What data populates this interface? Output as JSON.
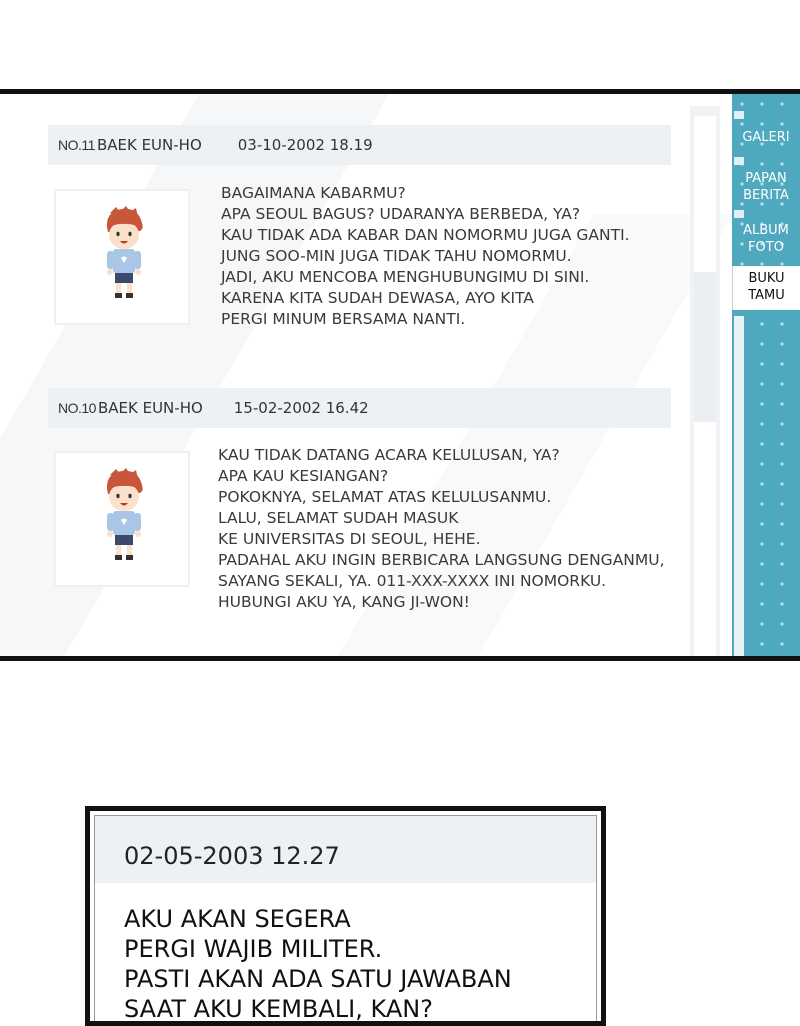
{
  "tabs": [
    {
      "label_line1": "GALERI",
      "label_line2": ""
    },
    {
      "label_line1": "PAPAN",
      "label_line2": "BERITA"
    },
    {
      "label_line1": "ALBUM",
      "label_line2": "FOTO"
    },
    {
      "label_line1": "BUKU",
      "label_line2": "TAMU"
    }
  ],
  "active_tab": "BUKU TAMU",
  "entries": [
    {
      "no": "NO.11",
      "author": "BAEK EUN-HO",
      "datetime": "03-10-2002 18.19",
      "avatar": "boy-avatar-icon",
      "lines": [
        "BAGAIMANA KABARMU?",
        "APA SEOUL BAGUS? UDARANYA BERBEDA, YA?",
        "KAU TIDAK ADA KABAR DAN NOMORMU JUGA GANTI.",
        "JUNG SOO-MIN JUGA TIDAK TAHU NOMORMU.",
        "JADI, AKU MENCOBA MENGHUBUNGIMU DI SINI.",
        "KARENA KITA SUDAH DEWASA, AYO KITA",
        "PERGI MINUM BERSAMA NANTI."
      ]
    },
    {
      "no": "NO.10",
      "author": "BAEK EUN-HO",
      "datetime": "15-02-2002 16.42",
      "avatar": "boy-avatar-icon",
      "lines": [
        "KAU TIDAK DATANG ACARA KELULUSAN, YA?",
        "APA KAU KESIANGAN?",
        "POKOKNYA, SELAMAT ATAS KELULUSANMU.",
        "LALU, SELAMAT SUDAH MASUK",
        "KE UNIVERSITAS DI SEOUL, HEHE.",
        "PADAHAL AKU INGIN BERBICARA LANGSUNG DENGANMU,",
        "SAYANG SEKALI, YA. 011-XXX-XXXX INI NOMORKU.",
        "HUBUNGI AKU YA, KANG JI-WON!"
      ]
    }
  ],
  "dialog": {
    "datetime": "02-05-2003 12.27",
    "lines": [
      "AKU AKAN SEGERA",
      "PERGI WAJIB MILITER.",
      "PASTI AKAN ADA SATU JAWABAN",
      "SAAT AKU KEMBALI, KAN?"
    ]
  },
  "colors": {
    "side_panel": "#4ea8be",
    "header_bar": "#eef1f4",
    "frame": "#111111"
  }
}
